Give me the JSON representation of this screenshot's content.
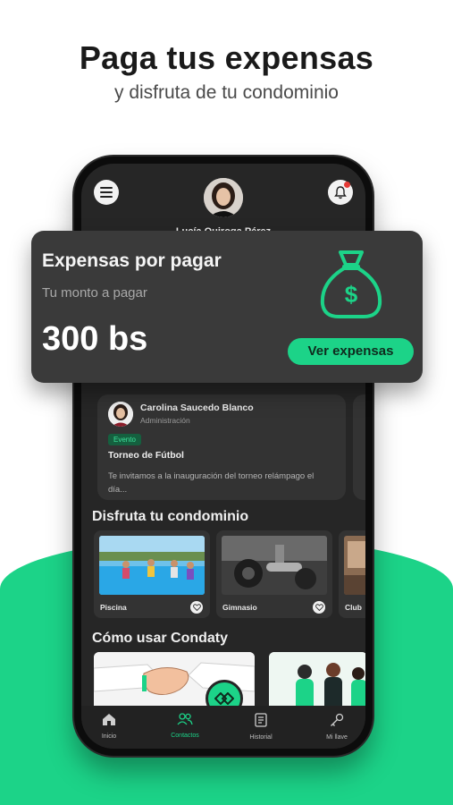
{
  "promo": {
    "headline": "Paga tus expensas",
    "subline": "y disfruta de tu condominio"
  },
  "header": {
    "user_name": "Lucía Quiroga Pérez",
    "menu_icon": "hamburger-menu-icon",
    "notif_icon": "bell-icon"
  },
  "expense_card": {
    "title": "Expensas por pagar",
    "subtitle": "Tu monto a pagar",
    "amount": "300 bs",
    "button_label": "Ver expensas",
    "icon": "money-bag-icon"
  },
  "post": {
    "author": "Carolina Saucedo Blanco",
    "role": "Administración",
    "tag": "Evento",
    "title": "Torneo de Fútbol",
    "body": "Te invitamos a la inauguración del torneo relámpago el día..."
  },
  "amenities": {
    "section_title": "Disfruta tu condominio",
    "items": [
      {
        "label": "Piscina"
      },
      {
        "label": "Gimnasio"
      },
      {
        "label": "Club"
      }
    ]
  },
  "how_to": {
    "section_title": "Cómo usar Condaty"
  },
  "navbar": {
    "items": [
      {
        "label": "Inicio",
        "icon": "home-icon"
      },
      {
        "label": "Contactos",
        "icon": "contacts-icon"
      },
      {
        "label": "Historial",
        "icon": "history-icon"
      },
      {
        "label": "Mi llave",
        "icon": "key-icon"
      }
    ],
    "active_index": 1
  },
  "colors": {
    "accent": "#1cd388",
    "card_bg": "#3a3a3a",
    "screen_bg": "#262626"
  }
}
